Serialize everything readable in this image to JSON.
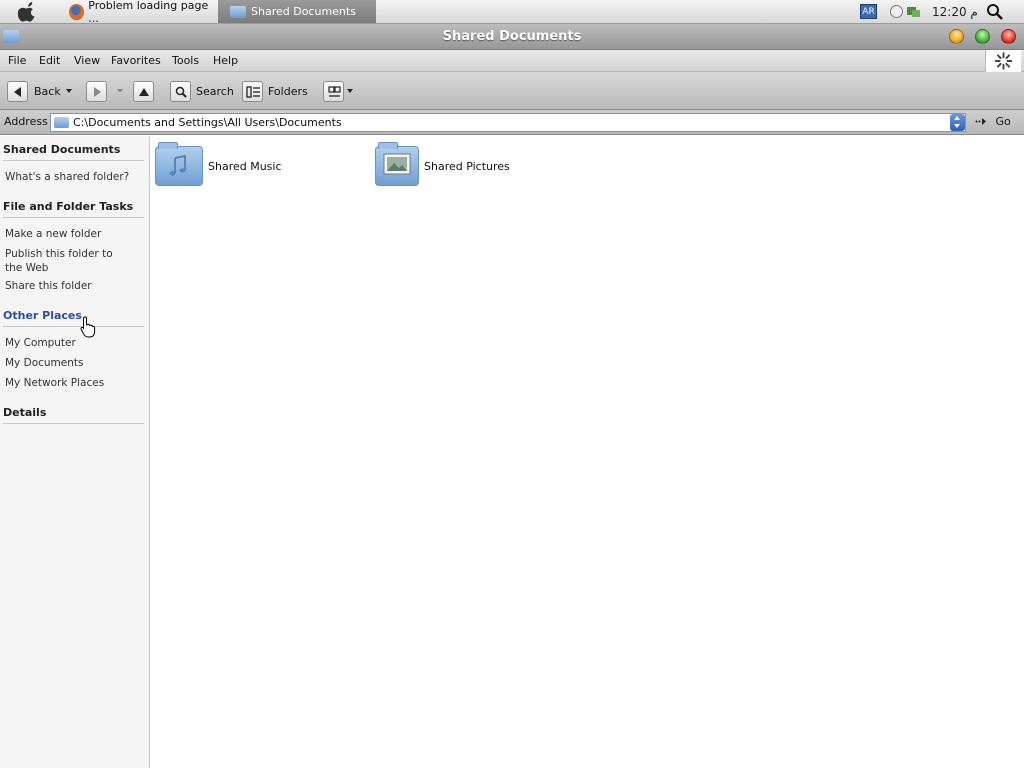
{
  "taskbar": {
    "tasks": [
      {
        "label": "Problem loading page ..."
      },
      {
        "label": "Shared Documents"
      }
    ],
    "language": "AR",
    "clock": "12:20 م"
  },
  "window": {
    "title": "Shared Documents"
  },
  "menu": [
    "File",
    "Edit",
    "View",
    "Favorites",
    "Tools",
    "Help"
  ],
  "toolbar": {
    "back_label": "Back",
    "search_label": "Search",
    "folders_label": "Folders"
  },
  "address": {
    "label": "Address",
    "value": "C:\\Documents and Settings\\All Users\\Documents",
    "go_label": "Go"
  },
  "sidebar": {
    "sections": [
      {
        "title": "Shared Documents",
        "links": [
          "What's a shared folder?"
        ]
      },
      {
        "title": "File and Folder Tasks",
        "links": [
          "Make a new folder",
          "Publish this folder to the Web",
          "Share this folder"
        ]
      },
      {
        "title": "Other Places",
        "links": [
          "My Computer",
          "My Documents",
          "My Network Places"
        ]
      },
      {
        "title": "Details",
        "links": []
      }
    ]
  },
  "content": {
    "items": [
      {
        "label": "Shared Music",
        "icon": "music-folder-icon"
      },
      {
        "label": "Shared Pictures",
        "icon": "pictures-folder-icon"
      }
    ]
  },
  "colors": {
    "accent_link": "#2a4ea3",
    "window_chrome": "#9c9c9c",
    "close": "#e33a2c",
    "minimize": "#f0a820",
    "maximize": "#4bb33c"
  }
}
